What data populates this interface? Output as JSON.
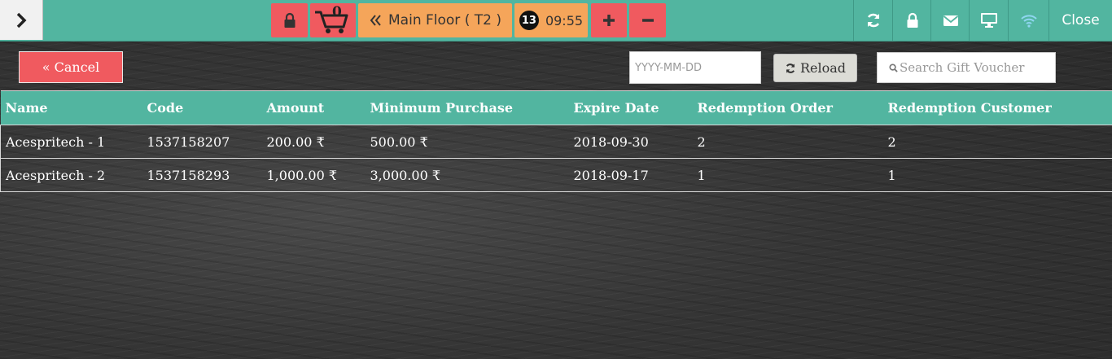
{
  "topbar": {
    "cart_count": "0",
    "floor_label": "Main Floor ( T2 )",
    "timer_badge": "13",
    "timer": "09:55",
    "close_label": "Close"
  },
  "actions": {
    "cancel_label": "« Cancel",
    "date_placeholder": "YYYY-MM-DD",
    "reload_label": "Reload",
    "search_placeholder": "Search Gift Voucher"
  },
  "table": {
    "headers": [
      "Name",
      "Code",
      "Amount",
      "Minimum Purchase",
      "Expire Date",
      "Redemption Order",
      "Redemption Customer"
    ],
    "rows": [
      [
        "Acespritech - 1",
        "1537158207",
        "200.00 ₹",
        "500.00 ₹",
        "2018-09-30",
        "2",
        "2"
      ],
      [
        "Acespritech - 2",
        "1537158293",
        "1,000.00 ₹",
        "3,000.00 ₹",
        "2018-09-17",
        "1",
        "1"
      ]
    ]
  },
  "colors": {
    "accent": "#52b5a0",
    "danger": "#f05a5f",
    "warning": "#f5a55a"
  }
}
